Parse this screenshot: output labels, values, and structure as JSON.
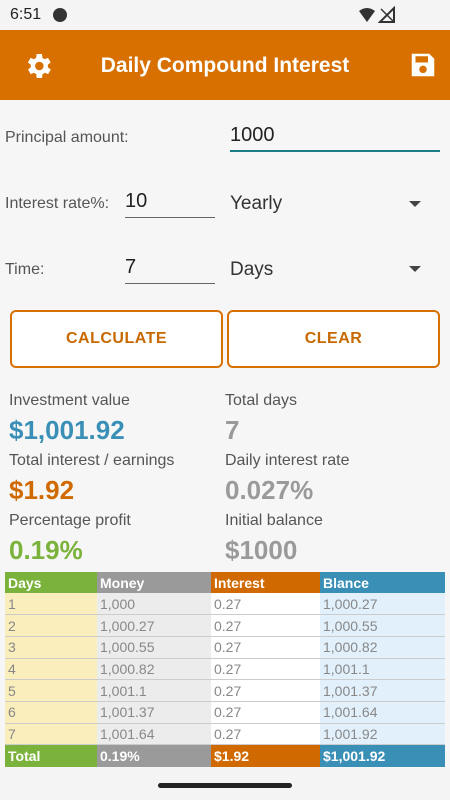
{
  "status_bar": {
    "time": "6:51"
  },
  "app_bar": {
    "title": "Daily Compound Interest",
    "settings_icon": "gear-icon",
    "save_icon": "floppy-disk-icon",
    "color": "#d87000"
  },
  "form": {
    "principal_label": "Principal amount:",
    "principal_value": "1000",
    "rate_label": "Interest rate%:",
    "rate_value": "10",
    "rate_period": "Yearly",
    "time_label": "Time:",
    "time_value": "7",
    "time_unit": "Days"
  },
  "buttons": {
    "calculate": "CALCULATE",
    "clear": "CLEAR"
  },
  "results": {
    "investment_label": "Investment value",
    "investment_value": "$1,001.92",
    "total_days_label": "Total days",
    "total_days_value": "7",
    "interest_label": "Total interest / earnings",
    "interest_value": "$1.92",
    "daily_rate_label": "Daily interest rate",
    "daily_rate_value": "0.027%",
    "profit_label": "Percentage profit",
    "profit_value": "0.19%",
    "initial_label": "Initial balance",
    "initial_value": "$1000"
  },
  "colors": {
    "blue": "#3a8fb7",
    "orange": "#d06a00",
    "green": "#7bb23c",
    "gray": "#9a9a9a"
  },
  "table": {
    "headers": [
      "Days",
      "Money",
      "Interest",
      "Blance"
    ],
    "rows": [
      [
        "1",
        "1,000",
        "0.27",
        "1,000.27"
      ],
      [
        "2",
        "1,000.27",
        "0.27",
        "1,000.55"
      ],
      [
        "3",
        "1,000.55",
        "0.27",
        "1,000.82"
      ],
      [
        "4",
        "1,000.82",
        "0.27",
        "1,001.1"
      ],
      [
        "5",
        "1,001.1",
        "0.27",
        "1,001.37"
      ],
      [
        "6",
        "1,001.37",
        "0.27",
        "1,001.64"
      ],
      [
        "7",
        "1,001.64",
        "0.27",
        "1,001.92"
      ]
    ],
    "total": [
      "Total",
      "0.19%",
      "$1.92",
      "$1,001.92"
    ]
  }
}
